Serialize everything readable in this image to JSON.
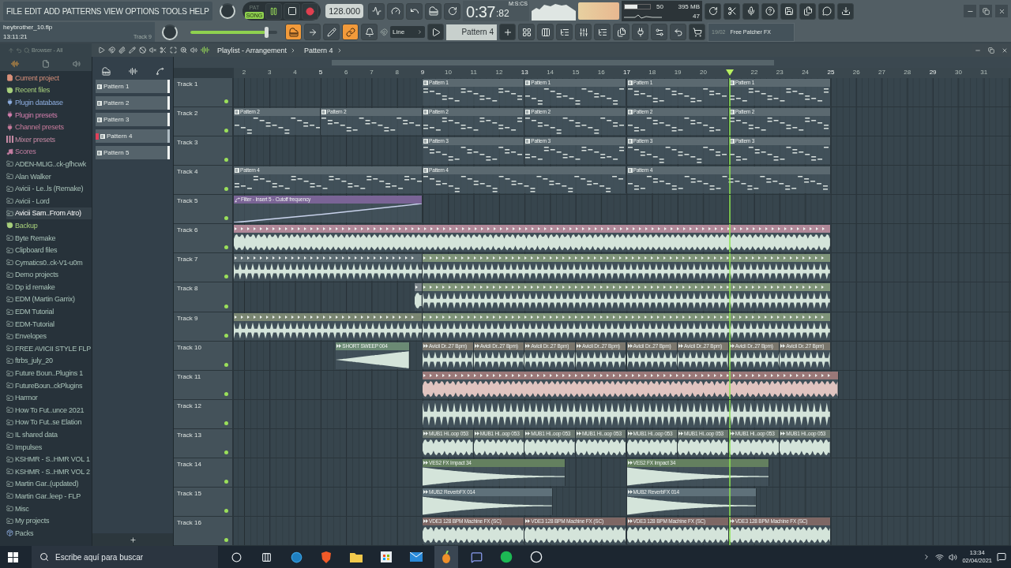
{
  "menu": [
    "FILE",
    "EDIT",
    "ADD",
    "PATTERNS",
    "VIEW",
    "OPTIONS",
    "TOOLS",
    "HELP"
  ],
  "hint": {
    "file": "heybrother_10.flp",
    "time": "13:11:21",
    "target": "Track 9"
  },
  "transport": {
    "modes": [
      {
        "label": "PAT",
        "selected": false
      },
      {
        "label": "SONG",
        "selected": true
      }
    ],
    "playing": true,
    "tempo": "128.000"
  },
  "master_volume": {
    "level": 0.86
  },
  "clock": {
    "time": "0:37",
    "centis": ":82",
    "units": "M:S:CS"
  },
  "cpu": {
    "level": 0.5,
    "cpu": "50",
    "memory": "395 MB",
    "polyphony": "47"
  },
  "snap": "Line",
  "pattern": "Pattern 4",
  "news": {
    "date": "19/02",
    "title": "Free Patcher FX"
  },
  "browser": {
    "title": "Browser - All",
    "items": [
      {
        "label": "Current project",
        "kind": "project",
        "color": "#d9907a",
        "selected": false
      },
      {
        "label": "Recent files",
        "kind": "recent",
        "color": "#a8d07c",
        "selected": false
      },
      {
        "label": "Plugin database",
        "kind": "database",
        "color": "#8eaee0",
        "selected": false
      },
      {
        "label": "Plugin presets",
        "kind": "presets",
        "color": "#d47fae",
        "selected": false
      },
      {
        "label": "Channel presets",
        "kind": "presets",
        "color": "#c97c9c",
        "selected": false
      },
      {
        "label": "Mixer presets",
        "kind": "mixer",
        "color": "#c58aa4",
        "selected": false
      },
      {
        "label": "Scores",
        "kind": "scores",
        "color": "#c47ea2",
        "selected": false
      },
      {
        "label": "ADEN-MLIG..ck-gfhcwk",
        "kind": "folder",
        "selected": false
      },
      {
        "label": "Alan Walker",
        "kind": "folder",
        "selected": false
      },
      {
        "label": "Avicii - Le..ls (Remake)",
        "kind": "folder",
        "selected": false
      },
      {
        "label": "Avicii - Lord",
        "kind": "folder",
        "selected": false
      },
      {
        "label": "Avicii Sam..From Atro)",
        "kind": "folder",
        "selected": true
      },
      {
        "label": "Backup",
        "kind": "recent",
        "color": "#a8d07c",
        "selected": false
      },
      {
        "label": "Byte Remake",
        "kind": "folder",
        "selected": false
      },
      {
        "label": "Clipboard files",
        "kind": "folder",
        "selected": false
      },
      {
        "label": "Cymatics0..ck-V1-u0m",
        "kind": "folder",
        "selected": false
      },
      {
        "label": "Demo projects",
        "kind": "folder",
        "selected": false
      },
      {
        "label": "Dp id remake",
        "kind": "folder",
        "selected": false
      },
      {
        "label": "EDM (Martin Garrix)",
        "kind": "folder",
        "selected": false
      },
      {
        "label": "EDM Tutorial",
        "kind": "folder",
        "selected": false
      },
      {
        "label": "EDM-Tutorial",
        "kind": "folder",
        "selected": false
      },
      {
        "label": "Envelopes",
        "kind": "folder",
        "selected": false
      },
      {
        "label": "FREE AVICII STYLE FLP",
        "kind": "folder",
        "selected": false
      },
      {
        "label": "ftrbs_july_20",
        "kind": "folder",
        "selected": false
      },
      {
        "label": "Future Boun..Plugins 1",
        "kind": "folder",
        "selected": false
      },
      {
        "label": "FutureBoun..ckPlugins",
        "kind": "folder",
        "selected": false
      },
      {
        "label": "Harmor",
        "kind": "folder",
        "selected": false
      },
      {
        "label": "How To Fut..unce 2021",
        "kind": "folder",
        "selected": false
      },
      {
        "label": "How To Fut..se Elation",
        "kind": "folder",
        "selected": false
      },
      {
        "label": "IL shared data",
        "kind": "folder",
        "selected": false
      },
      {
        "label": "Impulses",
        "kind": "folder",
        "selected": false
      },
      {
        "label": "KSHMR - S..HMR VOL 1",
        "kind": "folder",
        "selected": false
      },
      {
        "label": "KSHMR - S..HMR VOL 2",
        "kind": "folder",
        "selected": false
      },
      {
        "label": "Martin Gar..(updated)",
        "kind": "folder",
        "selected": false
      },
      {
        "label": "Martin Gar..leep - FLP",
        "kind": "folder",
        "selected": false
      },
      {
        "label": "Misc",
        "kind": "folder",
        "selected": false
      },
      {
        "label": "My projects",
        "kind": "folder",
        "selected": false
      },
      {
        "label": "Packs",
        "kind": "packs",
        "selected": false
      }
    ]
  },
  "picker": [
    {
      "label": "Pattern 1",
      "selected": false
    },
    {
      "label": "Pattern 2",
      "selected": false
    },
    {
      "label": "Pattern 3",
      "selected": false
    },
    {
      "label": "Pattern 4",
      "selected": true
    },
    {
      "label": "Pattern 5",
      "selected": false
    }
  ],
  "playlist": {
    "title": "Playlist - Arrangement",
    "pattern": "Pattern 4",
    "ruler": [
      "2",
      "3",
      "4",
      "5",
      "6",
      "7",
      "8",
      "9",
      "10",
      "11",
      "12",
      "13",
      "14",
      "15",
      "16",
      "17",
      "18",
      "19",
      "20",
      "22",
      "23",
      "24",
      "25",
      "26",
      "27",
      "28",
      "29",
      "30",
      "31"
    ],
    "tracks": [
      {
        "name": "Track 1",
        "clips": [
          {
            "kind": "pattern",
            "label": "Pattern 1"
          },
          {
            "kind": "pattern",
            "label": "Pattern 1"
          },
          {
            "kind": "pattern",
            "label": "Pattern 1"
          },
          {
            "kind": "pattern",
            "label": "Pattern 1"
          }
        ]
      },
      {
        "name": "Track 2",
        "clips": [
          {
            "kind": "pattern",
            "label": "Pattern 2"
          },
          {
            "kind": "pattern",
            "label": "Pattern 2"
          },
          {
            "kind": "pattern",
            "label": "Pattern 2"
          },
          {
            "kind": "pattern",
            "label": "Pattern 2"
          },
          {
            "kind": "pattern",
            "label": "Pattern 2"
          },
          {
            "kind": "pattern",
            "label": "Pattern 2"
          }
        ]
      },
      {
        "name": "Track 3",
        "clips": [
          {
            "kind": "pattern",
            "label": "Pattern 3"
          },
          {
            "kind": "pattern",
            "label": "Pattern 3"
          },
          {
            "kind": "pattern",
            "label": "Pattern 3"
          },
          {
            "kind": "pattern",
            "label": "Pattern 3"
          }
        ]
      },
      {
        "name": "Track 4",
        "clips": [
          {
            "kind": "pattern",
            "label": "Pattern 4"
          },
          {
            "kind": "pattern",
            "label": "Pattern 4"
          },
          {
            "kind": "pattern",
            "label": "Pattern 4"
          }
        ]
      },
      {
        "name": "Track 5",
        "clips": [
          {
            "kind": "automation",
            "label": "Filter - Insert 5 - Cutoff frequency",
            "color": "#7a6496"
          }
        ]
      },
      {
        "name": "Track 6",
        "clips": [
          {
            "kind": "slices",
            "color": "#b08898"
          }
        ]
      },
      {
        "name": "Track 7",
        "clips": [
          {
            "kind": "slices",
            "color": "#5f6e74"
          },
          {
            "kind": "slices",
            "color": "#7f9479"
          }
        ]
      },
      {
        "name": "Track 8",
        "clips": [
          {
            "kind": "slices",
            "color": "#7c858a"
          },
          {
            "kind": "slices",
            "color": "#7f9479"
          }
        ]
      },
      {
        "name": "Track 9",
        "clips": [
          {
            "kind": "slices",
            "color": "#7a8672"
          },
          {
            "kind": "slices",
            "color": "#7f9479"
          }
        ]
      },
      {
        "name": "Track 10",
        "clips": [
          {
            "kind": "audio",
            "label": "SHORT SWEEP 004",
            "color": "#6b8a74"
          },
          {
            "kind": "audio",
            "label": "Avicii Dr..27 Bpm)",
            "color": "#7a766c"
          },
          {
            "kind": "audio",
            "label": "Avicii Dr..27 Bpm)",
            "color": "#7a766c"
          },
          {
            "kind": "audio",
            "label": "Avicii Dr..27 Bpm)",
            "color": "#7a766c"
          },
          {
            "kind": "audio",
            "label": "Avicii Dr..27 Bpm)",
            "color": "#7a766c"
          },
          {
            "kind": "audio",
            "label": "Avicii Dr..27 Bpm)",
            "color": "#7a766c"
          },
          {
            "kind": "audio",
            "label": "Avicii Dr..27 Bpm)",
            "color": "#7a766c"
          },
          {
            "kind": "audio",
            "label": "Avicii Dr..27 Bpm)",
            "color": "#7a766c"
          },
          {
            "kind": "audio",
            "label": "Avicii Dr..27 Bpm)",
            "color": "#7a766c"
          }
        ]
      },
      {
        "name": "Track 11",
        "clips": [
          {
            "kind": "slices",
            "color": "#9a7878"
          }
        ]
      },
      {
        "name": "Track 12",
        "clips": [
          {
            "kind": "bare"
          }
        ]
      },
      {
        "name": "Track 13",
        "clips": [
          {
            "kind": "audio",
            "label": "MUB1 Hi..oop 053",
            "color": "#6a766f"
          },
          {
            "kind": "audio",
            "label": "MUB1 Hi..oop 053",
            "color": "#6a766f"
          },
          {
            "kind": "audio",
            "label": "MUB1 Hi..oop 053",
            "color": "#6a766f"
          },
          {
            "kind": "audio",
            "label": "MUB1 Hi..oop 053",
            "color": "#6a766f"
          },
          {
            "kind": "audio",
            "label": "MUB1 Hi..oop 053",
            "color": "#6a766f"
          },
          {
            "kind": "audio",
            "label": "MUB1 Hi..oop 053",
            "color": "#6a766f"
          },
          {
            "kind": "audio",
            "label": "MUB1 Hi..oop 053",
            "color": "#6a766f"
          },
          {
            "kind": "audio",
            "label": "MUB1 Hi..oop 053",
            "color": "#6a766f"
          }
        ]
      },
      {
        "name": "Track 14",
        "clips": [
          {
            "kind": "audio",
            "label": "VES2 FX Impact 34",
            "color": "#64805f"
          },
          {
            "kind": "audio",
            "label": "VES2 FX Impact 34",
            "color": "#64805f"
          }
        ]
      },
      {
        "name": "Track 15",
        "clips": [
          {
            "kind": "audio",
            "label": "MUB2 ReverbFX 014",
            "color": "#5f717a"
          },
          {
            "kind": "audio",
            "label": "MUB2 ReverbFX 014",
            "color": "#5f717a"
          }
        ]
      },
      {
        "name": "Track 16",
        "clips": [
          {
            "kind": "audio",
            "label": "VDE3 128 BPM Machine FX (SC)",
            "color": "#7e6764"
          },
          {
            "kind": "audio",
            "label": "VDE3 128 BPM Machine FX (SC)",
            "color": "#7e6764"
          },
          {
            "kind": "audio",
            "label": "VDE3 128 BPM Machine FX (SC)",
            "color": "#7e6764"
          },
          {
            "kind": "audio",
            "label": "VDE3 128 BPM Machine FX (SC)",
            "color": "#7e6764"
          }
        ]
      }
    ]
  },
  "taskbar": {
    "search": {
      "placeholder": "Escribe aquí para buscar"
    },
    "time": "13:34",
    "date": "02/04/2021"
  }
}
